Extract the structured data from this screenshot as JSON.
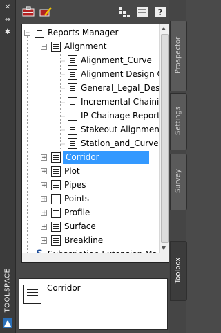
{
  "palette": {
    "title": "TOOLSPACE"
  },
  "tabs": [
    {
      "label": "Prospector",
      "active": false
    },
    {
      "label": "Settings",
      "active": false
    },
    {
      "label": "Survey",
      "active": false
    },
    {
      "label": "Toolbox",
      "active": true
    }
  ],
  "tree": {
    "root": "Reports Manager",
    "alignment": {
      "label": "Alignment",
      "children": [
        "Alignment_Curve",
        "Alignment Design C...",
        "General_Legal_Descr...",
        "Incremental Chainin...",
        "IP Chainage Report",
        "Stakeout Alignment...",
        "Station_and_Curve"
      ]
    },
    "categories": [
      "Corridor",
      "Plot",
      "Pipes",
      "Points",
      "Profile",
      "Surface",
      "Breakline"
    ],
    "selected": "Corridor",
    "extension": "Subscription Extension Ma..."
  },
  "preview": {
    "label": "Corridor"
  }
}
